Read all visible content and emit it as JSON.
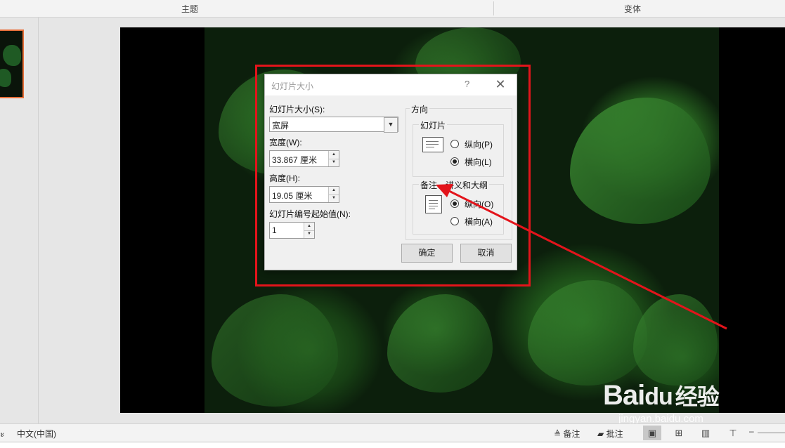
{
  "ribbon": {
    "group_theme": "主题",
    "group_variant": "变体"
  },
  "dialog": {
    "title": "幻灯片大小",
    "help_label": "?",
    "close_label": "✕",
    "size_label": "幻灯片大小(S):",
    "size_value": "宽屏",
    "width_label": "宽度(W):",
    "width_value": "33.867 厘米",
    "height_label": "高度(H):",
    "height_value": "19.05 厘米",
    "number_label": "幻灯片编号起始值(N):",
    "number_value": "1",
    "orientation_title": "方向",
    "slides_group": {
      "title": "幻灯片",
      "portrait": "纵向(P)",
      "landscape": "横向(L)",
      "selected": "landscape"
    },
    "notes_group": {
      "title": "备注、讲义和大纲",
      "portrait": "纵向(O)",
      "landscape": "横向(A)",
      "selected": "portrait"
    },
    "ok_label": "确定",
    "cancel_label": "取消"
  },
  "status": {
    "language": "中文(中国)",
    "notes": "备注",
    "comments": "批注",
    "left_fragment": "ะ"
  },
  "watermark": {
    "brand": "Bai",
    "brand2": "du",
    "brand_cn": "经验",
    "url": "jingyan.baidu.com"
  },
  "colors": {
    "annotation": "#e3141b",
    "thumb_border": "#e8703a"
  }
}
